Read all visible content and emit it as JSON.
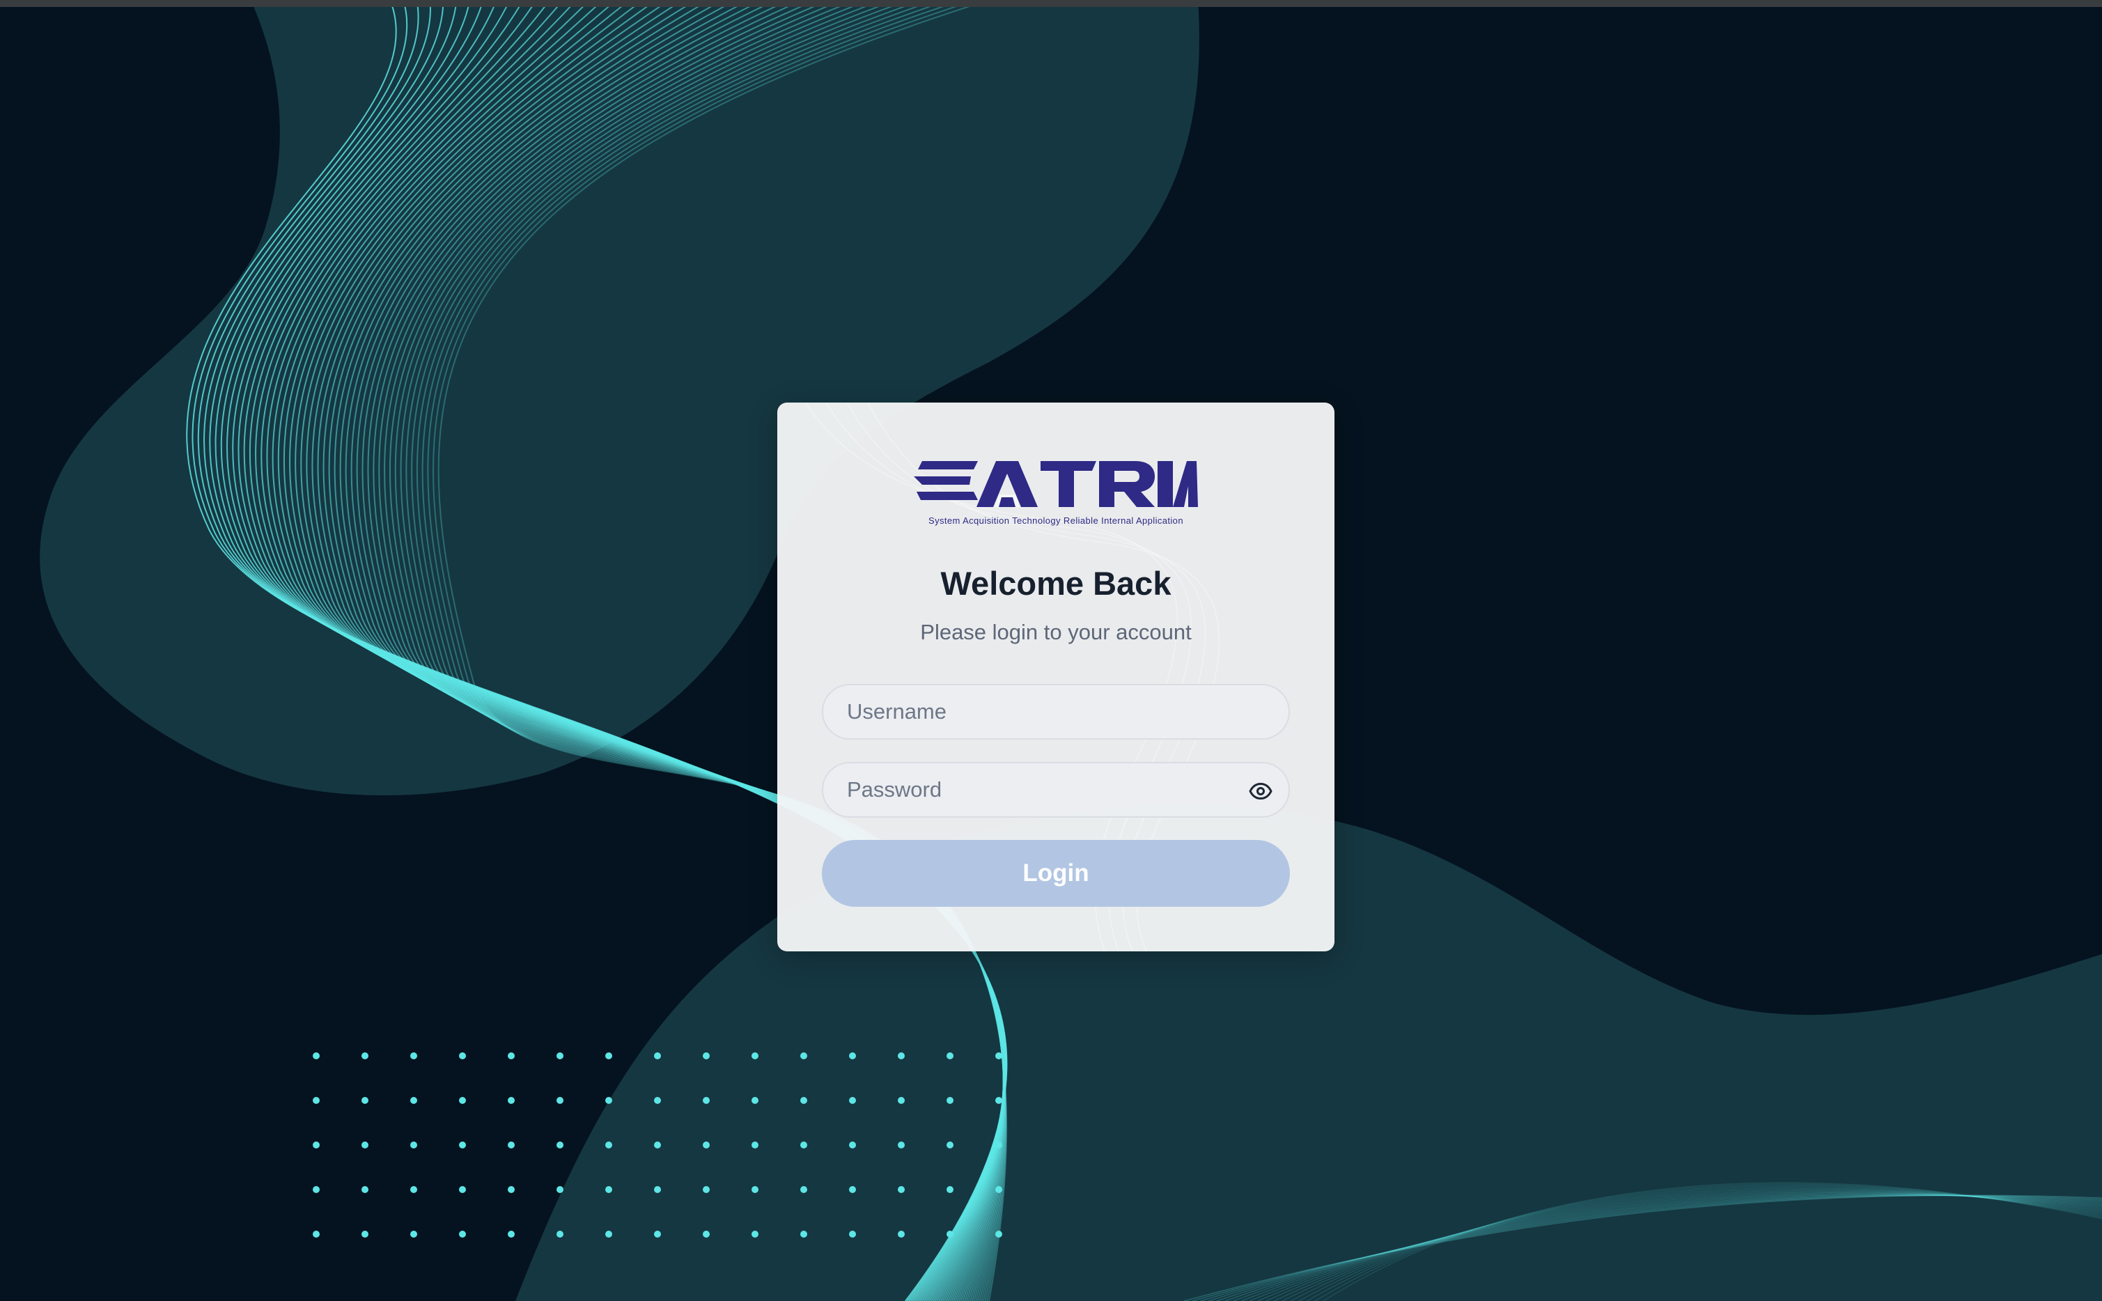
{
  "brand": {
    "name": "SATRIA",
    "tagline": "System Acquisition Technology Reliable Internal Application",
    "color": "#2e2a86"
  },
  "login": {
    "title": "Welcome Back",
    "subtitle": "Please login to your account",
    "username_placeholder": "Username",
    "password_placeholder": "Password",
    "show_password_icon": "eye-icon",
    "submit_label": "Login"
  },
  "theme": {
    "background": "#04131f",
    "wave_color": "#5ee6e6",
    "blob_color": "#153741",
    "card_background": "#f4f5f6",
    "button_color": "#b2c6e3"
  }
}
